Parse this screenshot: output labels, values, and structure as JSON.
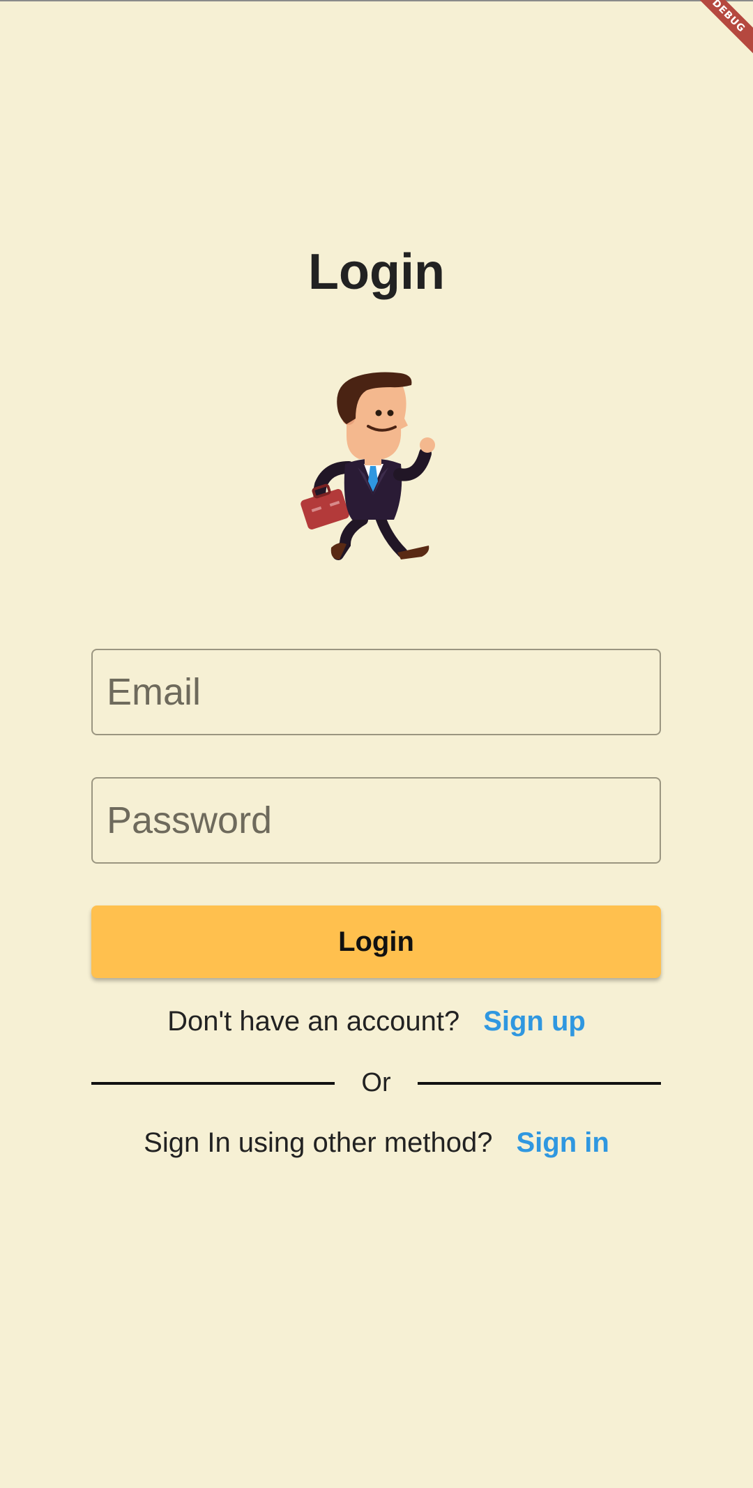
{
  "debug_banner": {
    "label": "DEBUG"
  },
  "page": {
    "title": "Login"
  },
  "illustration": {
    "icon": "businessman-walking-icon"
  },
  "form": {
    "email_placeholder": "Email",
    "password_placeholder": "Password",
    "login_label": "Login"
  },
  "signup": {
    "prompt": "Don't have an account?",
    "link": "Sign up"
  },
  "divider": {
    "label": "Or"
  },
  "signin": {
    "prompt": "Sign In using other method?",
    "link": "Sign in"
  },
  "colors": {
    "background": "#F6F0D4",
    "accent": "#FFC04E",
    "link": "#2F97E0",
    "text": "#222222"
  }
}
